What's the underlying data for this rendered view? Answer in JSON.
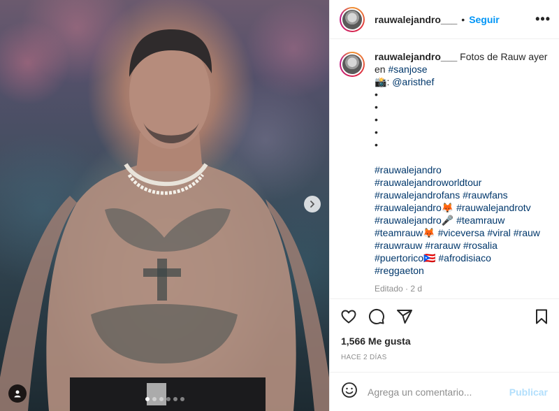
{
  "post": {
    "username": "rauwalejandro___",
    "separator": "•",
    "follow_label": "Seguir",
    "more_label": "•••"
  },
  "caption": {
    "username": "rauwalejandro___",
    "line1": " Fotos de Rauw ayer en ",
    "location_tag": "#sanjose",
    "camera_emoji": "📸",
    "colon": ": ",
    "mention": "@aristhef",
    "bullets": [
      "•",
      "•",
      "•",
      "•",
      "•"
    ],
    "hashtag_lines": [
      [
        "#rauwalejandro"
      ],
      [
        "#rauwalejandroworldtour"
      ],
      [
        "#rauwalejandrofans",
        "#rauwfans"
      ],
      [
        "#rauwalejandro🦊",
        "#rauwalejandrotv"
      ],
      [
        "#rauwalejandro🎤",
        "#teamrauw"
      ],
      [
        "#teamrauw🦊",
        "#viceversa",
        "#viral",
        "#rauw"
      ],
      [
        "#rauwrauw",
        "#rarauw",
        "#rosalia"
      ],
      [
        "#puertorico🇵🇷",
        "#afrodisiaco"
      ],
      [
        "#reggaeton"
      ]
    ],
    "edited": "Editado · 2 d"
  },
  "actions": {
    "like_icon": "heart-icon",
    "comment_icon": "comment-icon",
    "share_icon": "paper-plane-icon",
    "save_icon": "bookmark-icon"
  },
  "likes_text": "1,566 Me gusta",
  "time_ago": "HACE 2 DÍAS",
  "comment_box": {
    "placeholder": "Agrega un comentario...",
    "publish_label": "Publicar",
    "emoji_icon": "smiley-icon"
  },
  "carousel": {
    "total": 6,
    "active_index": 0
  },
  "colors": {
    "accent": "#0095f6",
    "publish_disabled": "#b2dffc",
    "hashtag": "#00376b",
    "muted": "#8e8e8e"
  }
}
